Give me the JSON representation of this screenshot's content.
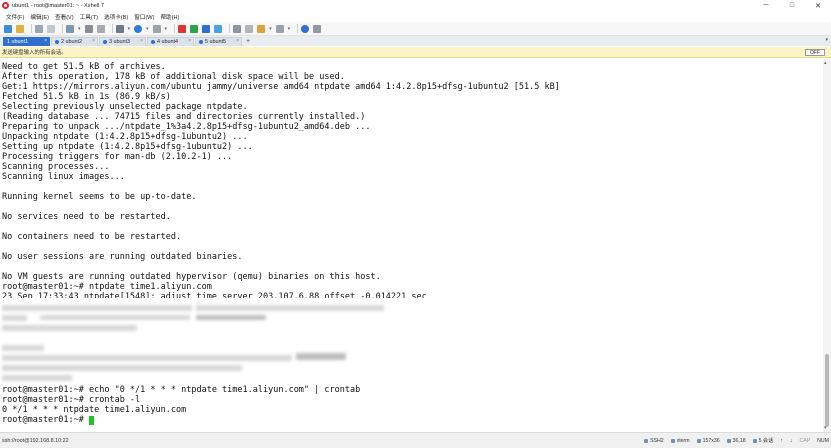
{
  "window": {
    "title": "ubunt1 - root@master01: ~ - Xshell 7",
    "minimize_label": "─",
    "maximize_label": "□",
    "close_label": "✕"
  },
  "menu": [
    "文件(F)",
    "编辑(E)",
    "查看(V)",
    "工具(T)",
    "选项卡(B)",
    "窗口(W)",
    "帮助(H)"
  ],
  "tabs": [
    {
      "label": "1 ubunt1",
      "active": true
    },
    {
      "label": "2 ubunt2",
      "active": false
    },
    {
      "label": "3 ubunt3",
      "active": false
    },
    {
      "label": "4 ubunt4",
      "active": false
    },
    {
      "label": "5 ubunt5",
      "active": false
    }
  ],
  "tab_add_label": "+",
  "compose": {
    "text": "发送键盘输入的所有会话。",
    "off_label": "OFF"
  },
  "terminal": {
    "lines": [
      "Need to get 51.5 kB of archives.",
      "After this operation, 178 kB of additional disk space will be used.",
      "Get:1 https://mirrors.aliyun.com/ubuntu jammy/universe amd64 ntpdate amd64 1:4.2.8p15+dfsg-1ubuntu2 [51.5 kB]",
      "Fetched 51.5 kB in 1s (86.9 kB/s)",
      "Selecting previously unselected package ntpdate.",
      "(Reading database ... 74715 files and directories currently installed.)",
      "Preparing to unpack .../ntpdate_1%3a4.2.8p15+dfsg-1ubuntu2_amd64.deb ...",
      "Unpacking ntpdate (1:4.2.8p15+dfsg-1ubuntu2) ...",
      "Setting up ntpdate (1:4.2.8p15+dfsg-1ubuntu2) ...",
      "Processing triggers for man-db (2.10.2-1) ...",
      "Scanning processes...",
      "Scanning linux images...",
      "",
      "Running kernel seems to be up-to-date.",
      "",
      "No services need to be restarted.",
      "",
      "No containers need to be restarted.",
      "",
      "No user sessions are running outdated binaries.",
      "",
      "No VM guests are running outdated hypervisor (qemu) binaries on this host.",
      "root@master01:~# ntpdate time1.aliyun.com",
      "23 Sep 17:33:43 ntpdate[1548]: adjust time server 203.107.6.88 offset -0.014221 sec",
      "",
      "",
      "",
      "",
      "",
      "",
      "",
      "",
      "",
      "root@master01:~# echo \"0 */1 * * * ntpdate time1.aliyun.com\" | crontab",
      "root@master01:~# crontab -l",
      "0 */1 * * * ntpdate time1.aliyun.com",
      "root@master01:~# "
    ]
  },
  "status": {
    "connection": "ssh://root@192.168.8.10:22",
    "protocol": "SSH2",
    "term": "xterm",
    "size": "157x36",
    "position": "36,18",
    "sessions": "5 会话",
    "caps": "CAP",
    "num": "NUM"
  },
  "colors": {
    "accent_tab": "#2f6fd0",
    "cursor": "#22c322",
    "compose_bg": "#fbf3c4"
  }
}
